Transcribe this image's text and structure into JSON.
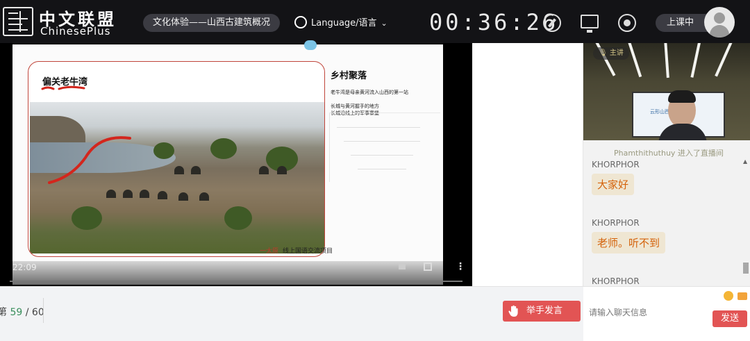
{
  "header": {
    "logo_cn": "中文联盟",
    "logo_en": "ChinesePlus",
    "course_title": "文化体验——山西古建筑概况",
    "language_label": "Language/语言",
    "timer": "00:36:26",
    "status": "上课中",
    "icons": [
      "compass-icon",
      "monitor-icon",
      "target-icon",
      "globe-icon",
      "chevron-down-icon",
      "avatar"
    ]
  },
  "slide": {
    "title": "偏关老牛湾",
    "heading": "乡村聚落",
    "line1": "老牛湾是母亲黄河流入山西的第一站",
    "line2": "长城与黄河握手的地方",
    "line3": "长城沿线上的军事寨堡",
    "caption_red": "一太原",
    "caption": "线上国语交流项目",
    "accent_red": "#c0453b"
  },
  "video": {
    "time": "22:09",
    "icons": [
      "volume-icon",
      "fullscreen-icon",
      "more-icon"
    ]
  },
  "footer": {
    "page_label": "第",
    "page_current": "59",
    "page_sep": " / ",
    "page_total": "60",
    "raise_hand": "举手发言",
    "accent": "#e25454"
  },
  "camera": {
    "mic_label": "主讲",
    "screen_label": "云形山西"
  },
  "chat": {
    "system": "Phamthithuthuy 进入了直播间",
    "messages": [
      {
        "sender": "KHORPHOR",
        "text": "大家好"
      },
      {
        "sender": "KHORPHOR",
        "text": "老师。听不到"
      },
      {
        "sender": "KHORPHOR",
        "text": ""
      }
    ],
    "input_placeholder": "请输入聊天信息",
    "send": "发送",
    "icons": [
      "emoji-icon",
      "folder-icon"
    ]
  }
}
